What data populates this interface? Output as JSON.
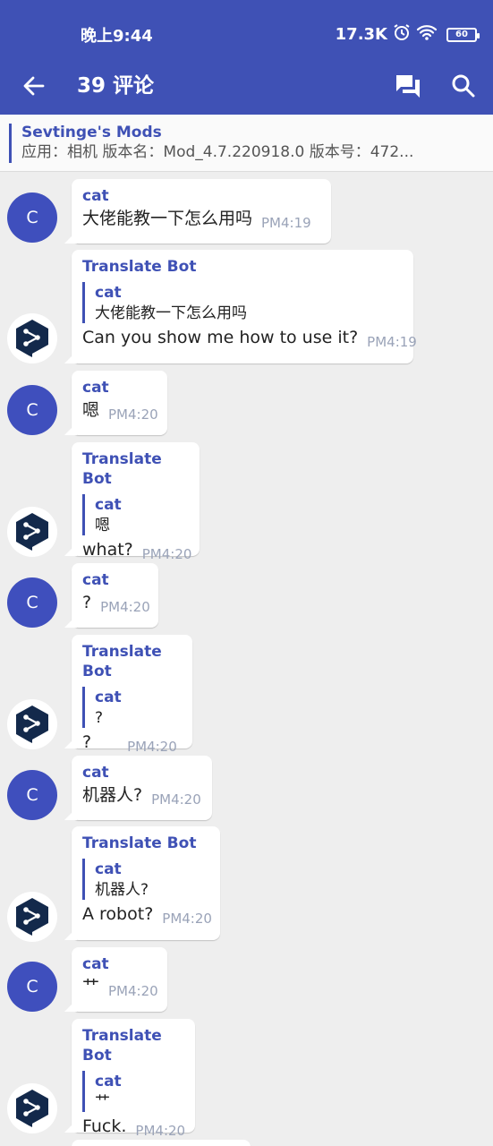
{
  "status_bar": {
    "time": "晚上9:44",
    "net_speed": "17.3K",
    "battery": "60"
  },
  "app_bar": {
    "title": "39 评论"
  },
  "channel": {
    "name": "Sevtinge's Mods",
    "description": "应用：相机 版本名：Mod_4.7.220918.0 版本号：472..."
  },
  "messages": [
    {
      "sender": "cat",
      "text": "大佬能教一下怎么用吗",
      "time": "PM4:19",
      "avatar": "C"
    },
    {
      "sender": "Translate Bot",
      "quote_sender": "cat",
      "quote_text": "大佬能教一下怎么用吗",
      "text": "Can you show me how to use it?",
      "time": "PM4:19"
    },
    {
      "sender": "cat",
      "text": "嗯",
      "time": "PM4:20",
      "avatar": "C"
    },
    {
      "sender": "Translate Bot",
      "quote_sender": "cat",
      "quote_text": "嗯",
      "text": "what?",
      "time": "PM4:20"
    },
    {
      "sender": "cat",
      "text": "?",
      "time": "PM4:20",
      "avatar": "C"
    },
    {
      "sender": "Translate Bot",
      "quote_sender": "cat",
      "quote_text": "?",
      "text": "?",
      "time": "PM4:20"
    },
    {
      "sender": "cat",
      "text": "机器人?",
      "time": "PM4:20",
      "avatar": "C"
    },
    {
      "sender": "Translate Bot",
      "quote_sender": "cat",
      "quote_text": "机器人?",
      "text": "A robot?",
      "time": "PM4:20"
    },
    {
      "sender": "cat",
      "text": "艹",
      "time": "PM4:20",
      "avatar": "C"
    },
    {
      "sender": "Translate Bot",
      "quote_sender": "cat",
      "quote_text": "艹",
      "text": "Fuck.",
      "time": "PM4:20"
    }
  ],
  "colors": {
    "primary": "#3f51b5",
    "background": "#eeeeee",
    "bot_icon": "#13294b",
    "time": "#9aa3b8"
  },
  "icons": [
    "back-arrow-icon",
    "comments-icon",
    "search-icon",
    "translate-bot-icon",
    "alarm-icon",
    "wifi-icon",
    "battery-icon"
  ]
}
